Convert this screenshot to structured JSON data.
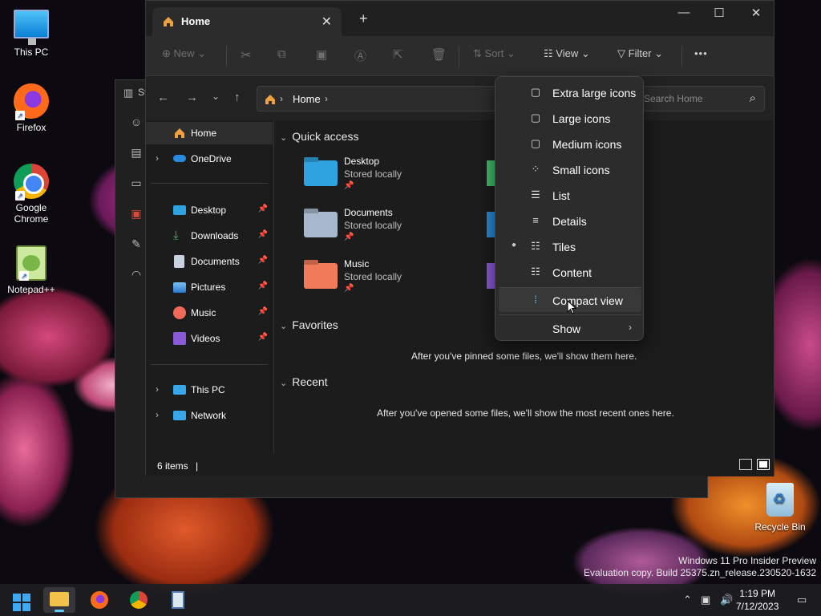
{
  "desktop": {
    "icons": [
      {
        "label": "This PC"
      },
      {
        "label": "Firefox"
      },
      {
        "label": "Google Chrome"
      },
      {
        "label": "Notepad++"
      },
      {
        "label": "Recycle Bin"
      }
    ],
    "watermark": {
      "line1": "Windows 11 Pro Insider Preview",
      "line2": "Evaluation copy. Build 25375.zn_release.230520-1632"
    }
  },
  "background_window": {
    "title": "St"
  },
  "explorer": {
    "tab_label": "Home",
    "toolbar": {
      "new_label": "New",
      "sort_label": "Sort",
      "view_label": "View",
      "filter_label": "Filter",
      "more_label": "•••"
    },
    "address": {
      "crumb": "Home",
      "search_placeholder": "Search Home"
    },
    "nav": {
      "home": "Home",
      "onedrive": "OneDrive",
      "pinned": [
        {
          "label": "Desktop",
          "icon": "desktop-icon",
          "color": "#2fa3e0"
        },
        {
          "label": "Downloads",
          "icon": "download-icon",
          "color": "#3fbf6a"
        },
        {
          "label": "Documents",
          "icon": "documents-icon",
          "color": "#c9d3e0"
        },
        {
          "label": "Pictures",
          "icon": "pictures-icon",
          "color": "#4aa8e8"
        },
        {
          "label": "Music",
          "icon": "music-icon",
          "color": "#f06a5a"
        },
        {
          "label": "Videos",
          "icon": "videos-icon",
          "color": "#8a5ad8"
        }
      ],
      "this_pc": "This PC",
      "network": "Network"
    },
    "content": {
      "quick_access_heading": "Quick access",
      "quick_access": [
        {
          "name": "Desktop",
          "sub": "Stored locally",
          "color": "#2fa3e0"
        },
        {
          "name": "Documents",
          "sub": "Stored locally",
          "color": "#a8b8cc"
        },
        {
          "name": "Music",
          "sub": "Stored locally",
          "color": "#f07a5a"
        }
      ],
      "favorites_heading": "Favorites",
      "favorites_empty": "After you've pinned some files, we'll show them here.",
      "recent_heading": "Recent",
      "recent_empty": "After you've opened some files, we'll show the most recent ones here."
    },
    "status": {
      "count": "6 items"
    }
  },
  "view_menu": {
    "items": [
      {
        "label": "Extra large icons",
        "icon": "square-icon",
        "glyph": "▢"
      },
      {
        "label": "Large icons",
        "icon": "square-icon",
        "glyph": "▢"
      },
      {
        "label": "Medium icons",
        "icon": "square-icon",
        "glyph": "▢"
      },
      {
        "label": "Small icons",
        "icon": "grid-icon",
        "glyph": "⁘"
      },
      {
        "label": "List",
        "icon": "list-icon",
        "glyph": "☰"
      },
      {
        "label": "Details",
        "icon": "details-icon",
        "glyph": "≡"
      },
      {
        "label": "Tiles",
        "icon": "tiles-icon",
        "glyph": "☷",
        "selected": true
      },
      {
        "label": "Content",
        "icon": "content-icon",
        "glyph": "☷"
      }
    ],
    "compact": {
      "label": "Compact view",
      "icon": "compact-icon",
      "glyph": "⁞"
    },
    "show": {
      "label": "Show"
    }
  },
  "taskbar": {
    "clock_time": "1:19 PM",
    "clock_date": "7/12/2023",
    "accent": "#60cdff"
  }
}
